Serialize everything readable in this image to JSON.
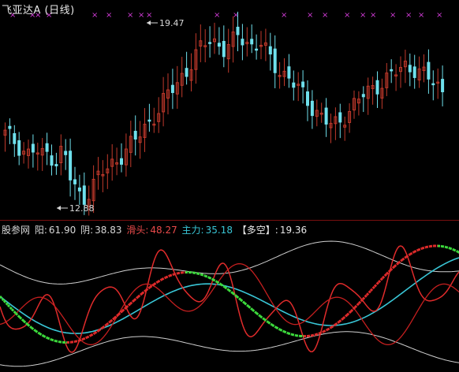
{
  "header": {
    "title": "飞亚达A (日线)"
  },
  "price_chart": {
    "high_label": "19.47",
    "low_label": "12.88",
    "colors": {
      "up": "#c0392b",
      "down": "#6fe0ec",
      "marker": "#d13bd6"
    }
  },
  "indicator_bar": {
    "name": "股参网",
    "yang_label": "阳:",
    "yang_value": "61.90",
    "yin_label": "阴:",
    "yin_value": "38.83",
    "hua_label": "滑头:",
    "hua_value": "48.27",
    "zhu_label": "主力:",
    "zhu_value": "35.18",
    "duo_label": "【多空】:",
    "duo_value": "19.36"
  },
  "chart_data": [
    {
      "type": "candlestick",
      "title": "飞亚达A (日线)",
      "annotations": [
        "19.47",
        "12.88"
      ],
      "approx_close": [
        15.4,
        15.2,
        14.9,
        14.6,
        14.8,
        14.5,
        14.7,
        14.3,
        14.9,
        13.6,
        13.0,
        12.9,
        13.4,
        13.8,
        14.0,
        14.3,
        14.6,
        14.9,
        15.2,
        15.6,
        16.0,
        16.3,
        16.8,
        17.2,
        17.6,
        17.9,
        18.4,
        18.8,
        19.2,
        19.0,
        18.7,
        18.9,
        19.3,
        19.1,
        18.8,
        19.0,
        18.5,
        18.1,
        17.8,
        17.6,
        17.2,
        16.9,
        16.5,
        16.2,
        15.9,
        15.7,
        15.9,
        16.3,
        16.6,
        16.9,
        17.1,
        17.3,
        17.5,
        17.7,
        17.9,
        18.1,
        18.0,
        17.8,
        17.6,
        17.4,
        17.1
      ]
    },
    {
      "type": "line",
      "series": [
        {
          "name": "阳",
          "values": [
            61.9
          ]
        },
        {
          "name": "阴",
          "values": [
            38.83
          ]
        },
        {
          "name": "滑头",
          "values": [
            48.27
          ]
        },
        {
          "name": "主力",
          "values": [
            35.18
          ]
        },
        {
          "name": "多空",
          "values": [
            19.36
          ]
        }
      ]
    }
  ]
}
